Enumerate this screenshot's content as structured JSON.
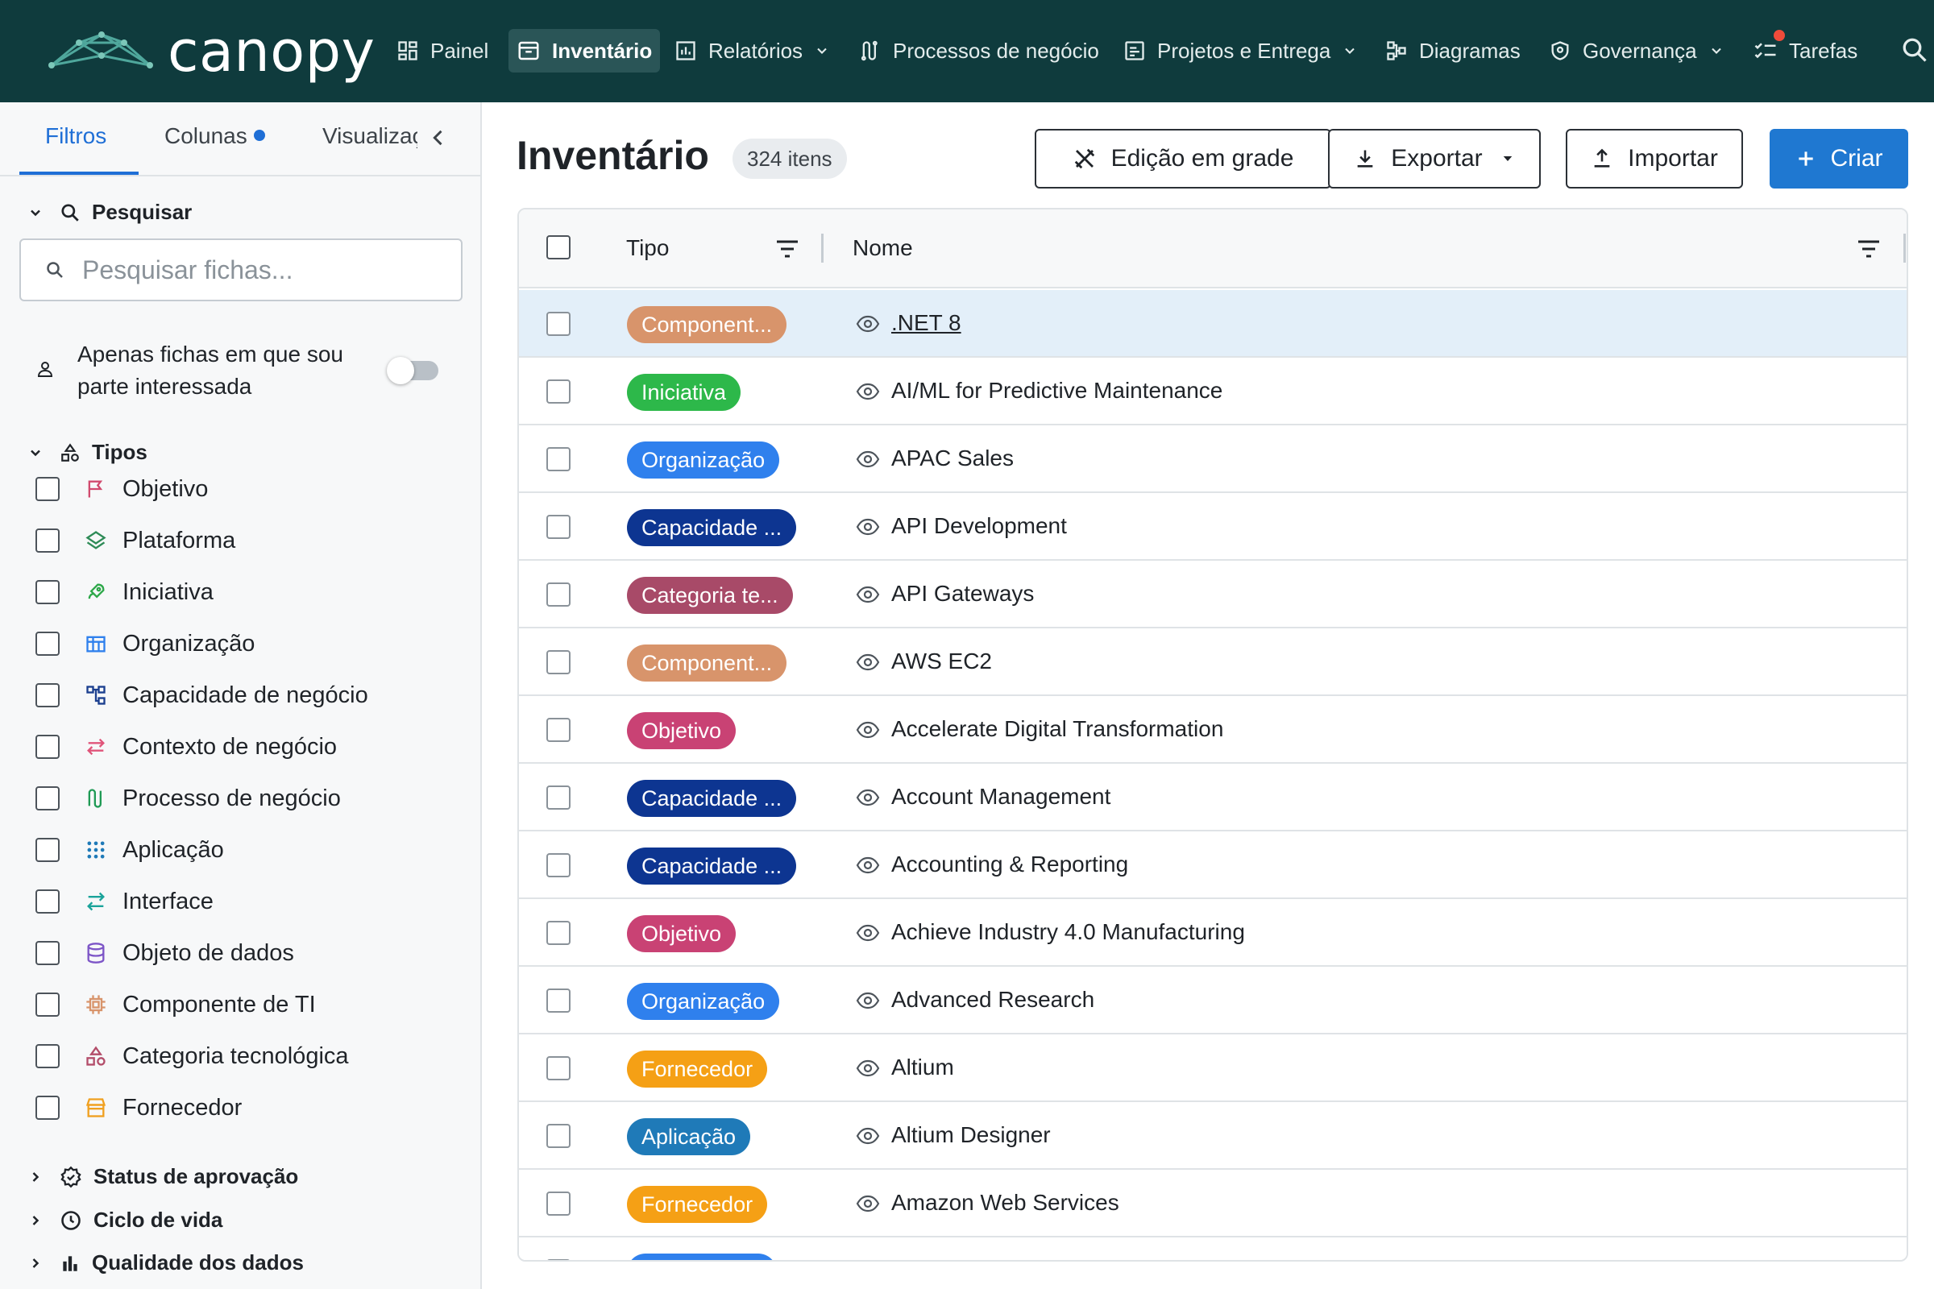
{
  "app": {
    "brand": "canopy"
  },
  "nav": {
    "items": [
      {
        "label": "Painel"
      },
      {
        "label": "Inventário"
      },
      {
        "label": "Relatórios"
      },
      {
        "label": "Processos de negócio"
      },
      {
        "label": "Projetos e Entrega"
      },
      {
        "label": "Diagramas"
      },
      {
        "label": "Governança"
      },
      {
        "label": "Tarefas"
      }
    ]
  },
  "sidebar": {
    "tabs": {
      "filters": "Filtros",
      "columns": "Colunas",
      "views": "Visualizações"
    },
    "search": {
      "heading": "Pesquisar",
      "placeholder": "Pesquisar fichas..."
    },
    "stakeholder_toggle": {
      "label": "Apenas fichas em que sou parte interessada",
      "on": false
    },
    "types": {
      "heading": "Tipos",
      "items": [
        {
          "label": "Objetivo",
          "icon": "flag-icon",
          "color": "#d14a6e"
        },
        {
          "label": "Plataforma",
          "icon": "layers-icon",
          "color": "#2e8b57"
        },
        {
          "label": "Iniciativa",
          "icon": "rocket-icon",
          "color": "#2ea84a"
        },
        {
          "label": "Organização",
          "icon": "building-icon",
          "color": "#2f80ed"
        },
        {
          "label": "Capacidade de negócio",
          "icon": "hierarchy-icon",
          "color": "#1b3f8f"
        },
        {
          "label": "Contexto de negócio",
          "icon": "swap-icon",
          "color": "#e0557a"
        },
        {
          "label": "Processo de negócio",
          "icon": "process-icon",
          "color": "#1f9a55"
        },
        {
          "label": "Aplicação",
          "icon": "grid-dots-icon",
          "color": "#1f7ab8"
        },
        {
          "label": "Interface",
          "icon": "arrows-exchange-icon",
          "color": "#1aa39a"
        },
        {
          "label": "Objeto de dados",
          "icon": "database-icon",
          "color": "#7d55c7"
        },
        {
          "label": "Componente de TI",
          "icon": "chip-icon",
          "color": "#d8946b"
        },
        {
          "label": "Categoria tecnológica",
          "icon": "shapes-icon",
          "color": "#b34d6a"
        },
        {
          "label": "Fornecedor",
          "icon": "store-icon",
          "color": "#f0a020"
        }
      ]
    },
    "sections": {
      "approval": "Status de aprovação",
      "lifecycle": "Ciclo de vida",
      "quality": "Qualidade dos dados"
    }
  },
  "main": {
    "title": "Inventário",
    "count": "324 itens",
    "buttons": {
      "grid_edit": "Edição em grade",
      "export": "Exportar",
      "import": "Importar",
      "create": "Criar"
    },
    "table": {
      "columns": {
        "type": "Tipo",
        "name": "Nome"
      },
      "rows": [
        {
          "type": "Component...",
          "name": ".NET 8",
          "color": "#d8946b"
        },
        {
          "type": "Iniciativa",
          "name": "AI/ML for Predictive Maintenance",
          "color": "#2db84a"
        },
        {
          "type": "Organização",
          "name": "APAC Sales",
          "color": "#2f80ed"
        },
        {
          "type": "Capacidade ...",
          "name": "API Development",
          "color": "#0d3591"
        },
        {
          "type": "Categoria te...",
          "name": "API Gateways",
          "color": "#a84a68"
        },
        {
          "type": "Component...",
          "name": "AWS EC2",
          "color": "#d8946b"
        },
        {
          "type": "Objetivo",
          "name": "Accelerate Digital Transformation",
          "color": "#c94274"
        },
        {
          "type": "Capacidade ...",
          "name": "Account Management",
          "color": "#0d3591"
        },
        {
          "type": "Capacidade ...",
          "name": "Accounting & Reporting",
          "color": "#0d3591"
        },
        {
          "type": "Objetivo",
          "name": "Achieve Industry 4.0 Manufacturing",
          "color": "#c94274"
        },
        {
          "type": "Organização",
          "name": "Advanced Research",
          "color": "#2f80ed"
        },
        {
          "type": "Fornecedor",
          "name": "Altium",
          "color": "#f5a015"
        },
        {
          "type": "Aplicação",
          "name": "Altium Designer",
          "color": "#1f7ab8"
        },
        {
          "type": "Fornecedor",
          "name": "Amazon Web Services",
          "color": "#f5a015"
        }
      ]
    }
  }
}
